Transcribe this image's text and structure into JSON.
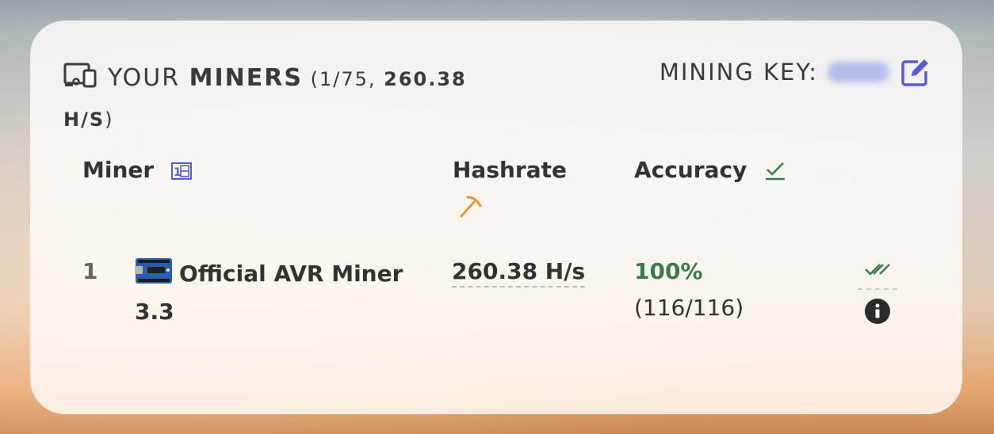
{
  "title": {
    "prefix": "YOUR",
    "main": "MINERS",
    "open": " (1/75, ",
    "hashrate": "260.38 H/S",
    "close": ")",
    "icon": "devices-icon"
  },
  "mining_key": {
    "label": "MINING KEY:",
    "edit_icon": "edit-icon"
  },
  "table": {
    "columns": [
      {
        "label": "Miner",
        "icon": "cpu-chip-icon"
      },
      {
        "label": "Hashrate",
        "icon": "pickaxe-icon"
      },
      {
        "label": "Accuracy",
        "icon": "check-icon"
      }
    ],
    "rows": [
      {
        "num": "1",
        "name": "Official AVR Miner 3.3",
        "board_icon": "arduino-board-icon",
        "hashrate": "260.38 H/s",
        "accuracy": "100%",
        "shares": "(116/116)",
        "status_icon": "double-check-icon",
        "info_icon": "info-icon"
      }
    ]
  },
  "colors": {
    "accent": "#5b5bd6",
    "pickaxe": "#e8923a",
    "check": "#3c7a4d"
  }
}
